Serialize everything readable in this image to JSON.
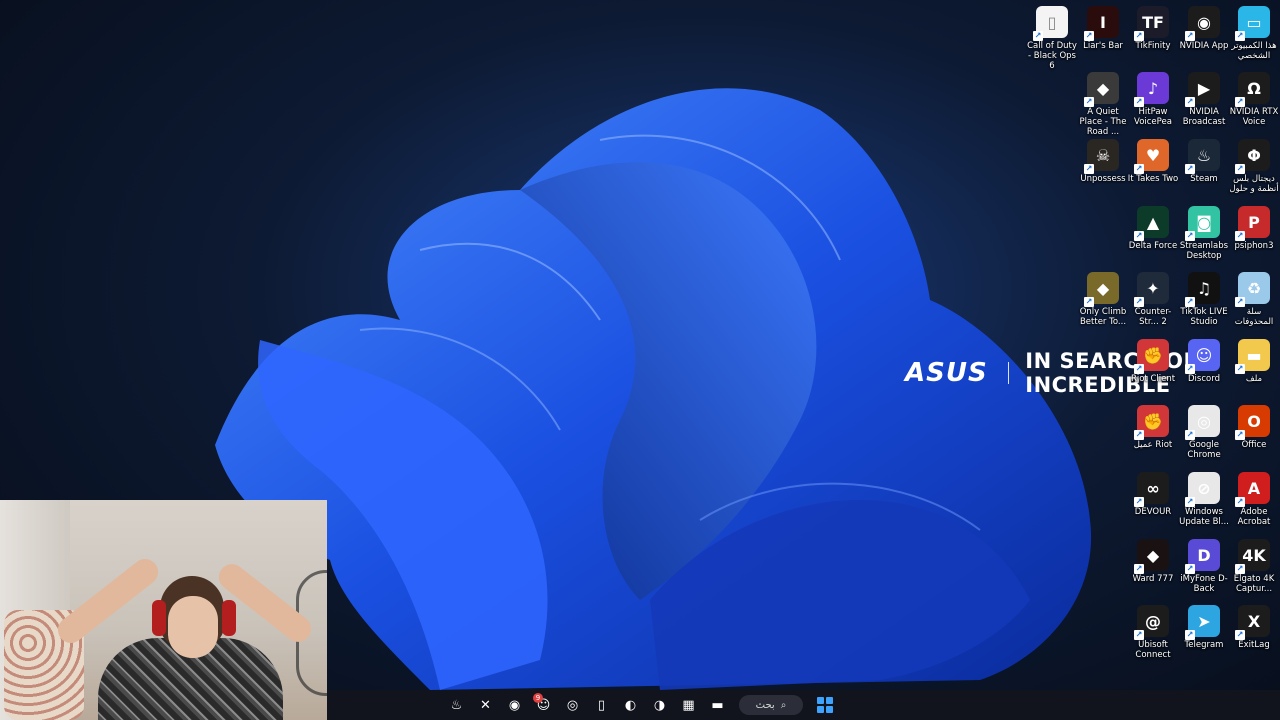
{
  "wallpaper": {
    "brand": "ASUS",
    "slogan": "IN SEARCH OF INCREDIBLE",
    "accent": "#1f5bff"
  },
  "desktop_icons": [
    {
      "label": "Call of Duty - Black Ops 6",
      "icon": "document-icon",
      "color": "#f4f4f4"
    },
    {
      "label": "Liar's Bar",
      "icon": "liars-bar-icon",
      "color": "#2a0c0c"
    },
    {
      "label": "TikFinity",
      "icon": "tikfinity-icon",
      "color": "#1b1b2a"
    },
    {
      "label": "NVIDIA App",
      "icon": "nvidia-icon",
      "color": "#1c1c1c"
    },
    {
      "label": "هذا الكمبيوتر الشخصي",
      "icon": "monitor-icon",
      "color": "#2ab6e6"
    },
    {
      "label": "A Quiet Place - The Road ...",
      "icon": "game-icon",
      "color": "#3a3a3a"
    },
    {
      "label": "HitPaw VoicePea",
      "icon": "hitpaw-icon",
      "color": "#6b3ad6"
    },
    {
      "label": "NVIDIA Broadcast",
      "icon": "nvidia-broadcast-icon",
      "color": "#1c1c1c"
    },
    {
      "label": "NVIDIA RTX Voice",
      "icon": "headset-icon",
      "color": "#1c1c1c"
    },
    {
      "label": "Unpossess",
      "icon": "skull-icon",
      "color": "#2a2622"
    },
    {
      "label": "It Takes Two",
      "icon": "it-takes-two-icon",
      "color": "#e0672a"
    },
    {
      "label": "Steam",
      "icon": "steam-icon",
      "color": "#1b2838"
    },
    {
      "label": "ديجتال بلس أنظمة و حلول",
      "icon": "digital-plus-icon",
      "color": "#1c1c1c"
    },
    {
      "label": "Delta Force",
      "icon": "delta-force-icon",
      "color": "#0d3b2a"
    },
    {
      "label": "Streamlabs Desktop",
      "icon": "streamlabs-icon",
      "color": "#31c3a2"
    },
    {
      "label": "psiphon3",
      "icon": "psiphon-icon",
      "color": "#c62a2a"
    },
    {
      "label": "Only Climb Better To...",
      "icon": "game-icon",
      "color": "#7a6a2a"
    },
    {
      "label": "Counter-Str... 2",
      "icon": "counter-strike-icon",
      "color": "#1f2a3a"
    },
    {
      "label": "TikTok LIVE Studio",
      "icon": "tiktok-icon",
      "color": "#111111"
    },
    {
      "label": "سلة المحذوفات",
      "icon": "recycle-bin-icon",
      "color": "#9bc9ea"
    },
    {
      "label": "Riot Client",
      "icon": "riot-icon",
      "color": "#d13639"
    },
    {
      "label": "Discord",
      "icon": "discord-icon",
      "color": "#5865f2"
    },
    {
      "label": "ملف",
      "icon": "folder-icon",
      "color": "#f2c94c"
    },
    {
      "label": "عميل Riot",
      "icon": "riot-icon",
      "color": "#d13639"
    },
    {
      "label": "Google Chrome",
      "icon": "chrome-icon",
      "color": "#e8e8e8"
    },
    {
      "label": "Office",
      "icon": "office-icon",
      "color": "#d83b01"
    },
    {
      "label": "DEVOUR",
      "icon": "devour-icon",
      "color": "#1c1c1c"
    },
    {
      "label": "Windows Update Bl...",
      "icon": "windows-update-icon",
      "color": "#e8e8e8"
    },
    {
      "label": "Adobe Acrobat",
      "icon": "acrobat-icon",
      "color": "#d01e1e"
    },
    {
      "label": "Ward 777",
      "icon": "game-icon",
      "color": "#1a1212"
    },
    {
      "label": "iMyFone D-Back",
      "icon": "imyfone-icon",
      "color": "#5a4bd6"
    },
    {
      "label": "Elgato 4K Captur...",
      "icon": "elgato-icon",
      "color": "#1c1c1c"
    },
    {
      "label": "Ubisoft Connect",
      "icon": "ubisoft-icon",
      "color": "#1c1c1c"
    },
    {
      "label": "Telegram",
      "icon": "telegram-icon",
      "color": "#2ca5e0"
    },
    {
      "label": "ExitLag",
      "icon": "exitlag-icon",
      "color": "#1c1c1c"
    }
  ],
  "taskbar": {
    "search_label": "بحث",
    "apps": [
      {
        "icon": "steam-icon",
        "glyph": "♨"
      },
      {
        "icon": "app-icon",
        "glyph": "✕"
      },
      {
        "icon": "streamlabs-icon",
        "glyph": "◉"
      },
      {
        "icon": "discord-icon",
        "glyph": "☺",
        "badge": "9"
      },
      {
        "icon": "chrome-icon",
        "glyph": "◎"
      },
      {
        "icon": "file-icon",
        "glyph": "▯"
      },
      {
        "icon": "firefox-icon",
        "glyph": "◐"
      },
      {
        "icon": "edge-icon",
        "glyph": "◑"
      },
      {
        "icon": "store-icon",
        "glyph": "▦"
      },
      {
        "icon": "file-explorer-icon",
        "glyph": "▬"
      }
    ]
  }
}
